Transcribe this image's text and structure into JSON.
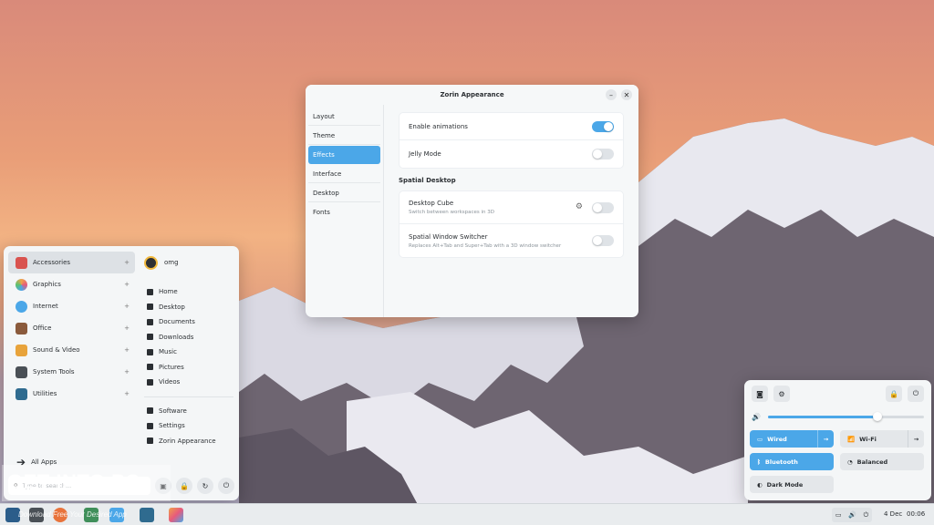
{
  "appearance_window": {
    "title": "Zorin Appearance",
    "sidebar": [
      "Layout",
      "Theme",
      "Effects",
      "Interface",
      "Desktop",
      "Fonts"
    ],
    "active_sidebar": "Effects",
    "effects": [
      {
        "label": "Enable animations",
        "enabled": true
      },
      {
        "label": "Jelly Mode",
        "enabled": false
      }
    ],
    "spatial_title": "Spatial Desktop",
    "spatial": [
      {
        "label": "Desktop Cube",
        "sub": "Switch between workspaces in 3D",
        "enabled": false
      },
      {
        "label": "Spatial Window Switcher",
        "sub": "Replaces Alt+Tab and Super+Tab with a 3D window switcher",
        "enabled": false
      }
    ]
  },
  "start_menu": {
    "categories": [
      "Accessories",
      "Graphics",
      "Internet",
      "Office",
      "Sound & Video",
      "System Tools",
      "Utilities"
    ],
    "category_colors": [
      "#d9534f",
      "#f0a24a",
      "#4ba7e8",
      "#8a5a3c",
      "#e8a33b",
      "#4a5056",
      "#2f6b8f"
    ],
    "user": "omg",
    "places": [
      "Home",
      "Desktop",
      "Documents",
      "Downloads",
      "Music",
      "Pictures",
      "Videos"
    ],
    "system_links": [
      "Software",
      "Settings",
      "Zorin Appearance"
    ],
    "all_apps": "All Apps",
    "search_placeholder": "Type to search..."
  },
  "quick_settings": {
    "volume_level": 0.7,
    "tiles": [
      {
        "label": "Wired",
        "on": true
      },
      {
        "label": "Wi-Fi",
        "on": false
      },
      {
        "label": "Bluetooth",
        "on": true
      },
      {
        "label": "Balanced",
        "on": false
      },
      {
        "label": "Dark Mode",
        "on": false
      }
    ]
  },
  "taskbar": {
    "date": "4 Dec",
    "time": "00:06"
  },
  "watermark": {
    "text": "GET INTO PC",
    "subtext": "Download Free Your Desired App"
  },
  "colors": {
    "accent": "#4ba7e8"
  }
}
